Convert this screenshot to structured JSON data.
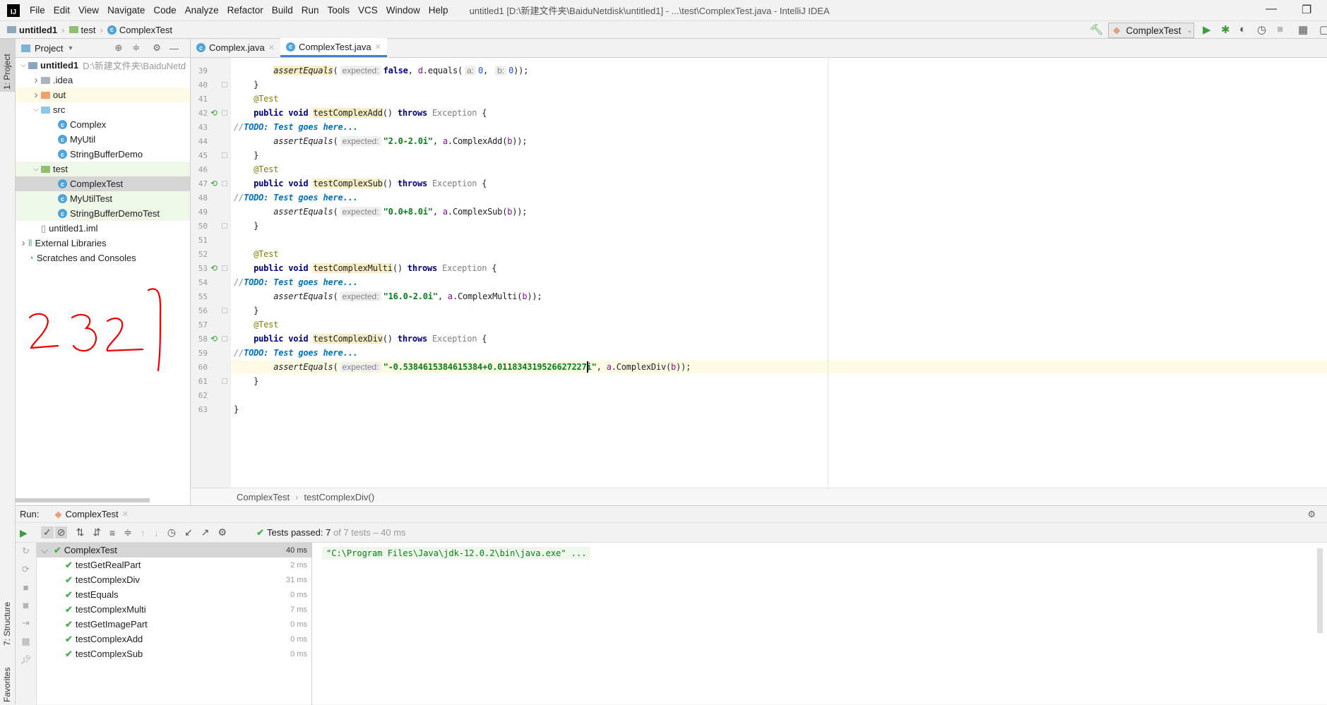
{
  "menubar": {
    "items": [
      "File",
      "Edit",
      "View",
      "Navigate",
      "Code",
      "Analyze",
      "Refactor",
      "Build",
      "Run",
      "Tools",
      "VCS",
      "Window",
      "Help"
    ],
    "title": "untitled1 [D:\\新建文件夹\\BaiduNetdisk\\untitled1] - ...\\test\\ComplexTest.java - IntelliJ IDEA",
    "logo": "IJ"
  },
  "navbar": {
    "crumbs": [
      "untitled1",
      "test",
      "ComplexTest"
    ],
    "run_config": "ComplexTest"
  },
  "left_stripe": {
    "project": "1: Project",
    "structure": "7: Structure",
    "favorites": "Favorites"
  },
  "project": {
    "header": "Project",
    "tree": [
      {
        "label": "untitled1",
        "extra": "D:\\新建文件夹\\BaiduNetd",
        "depth": 0,
        "arrow": "open",
        "icon": "module",
        "bold": true
      },
      {
        "label": ".idea",
        "depth": 1,
        "arrow": "closed",
        "icon": "folder-gray"
      },
      {
        "label": "out",
        "depth": 1,
        "arrow": "closed",
        "icon": "folder-orange",
        "bg": "#fdfbe6"
      },
      {
        "label": "src",
        "depth": 1,
        "arrow": "open",
        "icon": "folder-blue"
      },
      {
        "label": "Complex",
        "depth": 2,
        "icon": "class"
      },
      {
        "label": "MyUtil",
        "depth": 2,
        "icon": "class"
      },
      {
        "label": "StringBufferDemo",
        "depth": 2,
        "icon": "class"
      },
      {
        "label": "test",
        "depth": 1,
        "arrow": "open",
        "icon": "folder-green",
        "bg": "#eff7e9"
      },
      {
        "label": "ComplexTest",
        "depth": 2,
        "icon": "class",
        "bg": "#d5d5d5"
      },
      {
        "label": "MyUtilTest",
        "depth": 2,
        "icon": "class",
        "bg": "#eff7e9"
      },
      {
        "label": "StringBufferDemoTest",
        "depth": 2,
        "icon": "class",
        "bg": "#eff7e9"
      },
      {
        "label": "untitled1.iml",
        "depth": 1,
        "icon": "file"
      },
      {
        "label": "External Libraries",
        "depth": 0,
        "arrow": "closed",
        "icon": "library"
      },
      {
        "label": "Scratches and Consoles",
        "depth": 0,
        "icon": "scratch"
      }
    ],
    "handwriting": "2321"
  },
  "editor": {
    "tabs": [
      {
        "label": "Complex.java",
        "active": false
      },
      {
        "label": "ComplexTest.java",
        "active": true
      }
    ],
    "breadcrumb": [
      "ComplexTest",
      "testComplexDiv()"
    ],
    "current_line": 60,
    "lines": [
      {
        "n": 39,
        "t": [
          [
            "        ",
            ""
          ],
          [
            "assertEquals",
            "fn md"
          ],
          [
            "(",
            ""
          ],
          [
            "expected:",
            "hint"
          ],
          [
            "false",
            "kw"
          ],
          [
            ", ",
            ""
          ],
          [
            "d",
            "vr"
          ],
          [
            ".equals(",
            ""
          ],
          [
            "a:",
            "hint"
          ],
          [
            "0",
            "nm"
          ],
          [
            ", ",
            ""
          ],
          [
            "b:",
            "hint"
          ],
          [
            "0",
            "nm"
          ],
          [
            "));",
            ""
          ]
        ]
      },
      {
        "n": 40,
        "fold": true,
        "t": [
          [
            "    }",
            ""
          ]
        ]
      },
      {
        "n": 41,
        "t": [
          [
            "    ",
            ""
          ],
          [
            "@Test",
            "ann"
          ]
        ]
      },
      {
        "n": 42,
        "run": true,
        "fold": true,
        "t": [
          [
            "    ",
            ""
          ],
          [
            "public void ",
            "kw"
          ],
          [
            "testComplexAdd",
            "md"
          ],
          [
            "() ",
            ""
          ],
          [
            "throws ",
            "kw"
          ],
          [
            "Exception",
            "ex"
          ],
          [
            " {",
            ""
          ]
        ]
      },
      {
        "n": 43,
        "t": [
          [
            "//",
            "cm"
          ],
          [
            "TODO: Test goes here...",
            "todo"
          ]
        ]
      },
      {
        "n": 44,
        "t": [
          [
            "        ",
            ""
          ],
          [
            "assertEquals",
            "fn"
          ],
          [
            "(",
            ""
          ],
          [
            "expected:",
            "hint"
          ],
          [
            "\"2.0-2.0i\"",
            "str"
          ],
          [
            ", ",
            ""
          ],
          [
            "a",
            "vr"
          ],
          [
            ".ComplexAdd(",
            ""
          ],
          [
            "b",
            "vr"
          ],
          [
            "));",
            ""
          ]
        ]
      },
      {
        "n": 45,
        "fold": true,
        "t": [
          [
            "    }",
            ""
          ]
        ]
      },
      {
        "n": 46,
        "t": [
          [
            "    ",
            ""
          ],
          [
            "@Test",
            "ann"
          ]
        ]
      },
      {
        "n": 47,
        "run": true,
        "fold": true,
        "t": [
          [
            "    ",
            ""
          ],
          [
            "public void ",
            "kw"
          ],
          [
            "testComplexSub",
            "md"
          ],
          [
            "() ",
            ""
          ],
          [
            "throws ",
            "kw"
          ],
          [
            "Exception",
            "ex"
          ],
          [
            " {",
            ""
          ]
        ]
      },
      {
        "n": 48,
        "t": [
          [
            "//",
            "cm"
          ],
          [
            "TODO: Test goes here...",
            "todo"
          ]
        ]
      },
      {
        "n": 49,
        "t": [
          [
            "        ",
            ""
          ],
          [
            "assertEquals",
            "fn"
          ],
          [
            "(",
            ""
          ],
          [
            "expected:",
            "hint"
          ],
          [
            "\"0.0+8.0i\"",
            "str"
          ],
          [
            ", ",
            ""
          ],
          [
            "a",
            "vr"
          ],
          [
            ".ComplexSub(",
            ""
          ],
          [
            "b",
            "vr"
          ],
          [
            "));",
            ""
          ]
        ]
      },
      {
        "n": 50,
        "fold": true,
        "t": [
          [
            "    }",
            ""
          ]
        ]
      },
      {
        "n": 51,
        "t": []
      },
      {
        "n": 52,
        "t": [
          [
            "    ",
            ""
          ],
          [
            "@Test",
            "ann"
          ]
        ]
      },
      {
        "n": 53,
        "run": true,
        "fold": true,
        "t": [
          [
            "    ",
            ""
          ],
          [
            "public void ",
            "kw"
          ],
          [
            "testComplexMulti",
            "md"
          ],
          [
            "() ",
            ""
          ],
          [
            "throws ",
            "kw"
          ],
          [
            "Exception",
            "ex"
          ],
          [
            " {",
            ""
          ]
        ]
      },
      {
        "n": 54,
        "t": [
          [
            "//",
            "cm"
          ],
          [
            "TODO: Test goes here...",
            "todo"
          ]
        ]
      },
      {
        "n": 55,
        "t": [
          [
            "        ",
            ""
          ],
          [
            "assertEquals",
            "fn"
          ],
          [
            "(",
            ""
          ],
          [
            "expected:",
            "hint"
          ],
          [
            "\"16.0-2.0i\"",
            "str"
          ],
          [
            ", ",
            ""
          ],
          [
            "a",
            "vr"
          ],
          [
            ".ComplexMulti(",
            ""
          ],
          [
            "b",
            "vr"
          ],
          [
            "));",
            ""
          ]
        ]
      },
      {
        "n": 56,
        "fold": true,
        "t": [
          [
            "    }",
            ""
          ]
        ]
      },
      {
        "n": 57,
        "t": [
          [
            "    ",
            ""
          ],
          [
            "@Test",
            "ann"
          ]
        ]
      },
      {
        "n": 58,
        "run": true,
        "fold": true,
        "t": [
          [
            "    ",
            ""
          ],
          [
            "public void ",
            "kw"
          ],
          [
            "testComplexDiv",
            "md"
          ],
          [
            "() ",
            ""
          ],
          [
            "throws ",
            "kw"
          ],
          [
            "Exception",
            "ex"
          ],
          [
            " {",
            ""
          ]
        ]
      },
      {
        "n": 59,
        "t": [
          [
            "//",
            "cm"
          ],
          [
            "TODO: Test goes here...",
            "todo"
          ]
        ]
      },
      {
        "n": 60,
        "t": [
          [
            "        ",
            ""
          ],
          [
            "assertEquals",
            "fn"
          ],
          [
            "(",
            ""
          ],
          [
            "expected:",
            "hint"
          ],
          [
            "\"-0.5384615384615384+0.011834319526627227i\"",
            "str"
          ],
          [
            ", ",
            ""
          ],
          [
            "a",
            "vr"
          ],
          [
            ".ComplexDiv(",
            ""
          ],
          [
            "b",
            "vr"
          ],
          [
            "));",
            ""
          ]
        ]
      },
      {
        "n": 61,
        "fold": true,
        "t": [
          [
            "    }",
            ""
          ]
        ]
      },
      {
        "n": 62,
        "t": []
      },
      {
        "n": 63,
        "t": [
          [
            "}",
            ""
          ]
        ]
      }
    ]
  },
  "run": {
    "label": "Run:",
    "tab": "ComplexTest",
    "status_bold": "Tests passed: 7",
    "status_rest": "of 7 tests – 40 ms",
    "root": {
      "name": "ComplexTest",
      "time": "40 ms"
    },
    "tests": [
      {
        "name": "testGetRealPart",
        "time": "2 ms"
      },
      {
        "name": "testComplexDiv",
        "time": "31 ms"
      },
      {
        "name": "testEquals",
        "time": "0 ms"
      },
      {
        "name": "testComplexMulti",
        "time": "7 ms"
      },
      {
        "name": "testGetImagePart",
        "time": "0 ms"
      },
      {
        "name": "testComplexAdd",
        "time": "0 ms"
      },
      {
        "name": "testComplexSub",
        "time": "0 ms"
      }
    ],
    "console": "\"C:\\Program Files\\Java\\jdk-12.0.2\\bin\\java.exe\" ..."
  },
  "colors": {
    "accent": "#4083c9",
    "pass": "#4caf50",
    "run": "#3d9b3d"
  }
}
